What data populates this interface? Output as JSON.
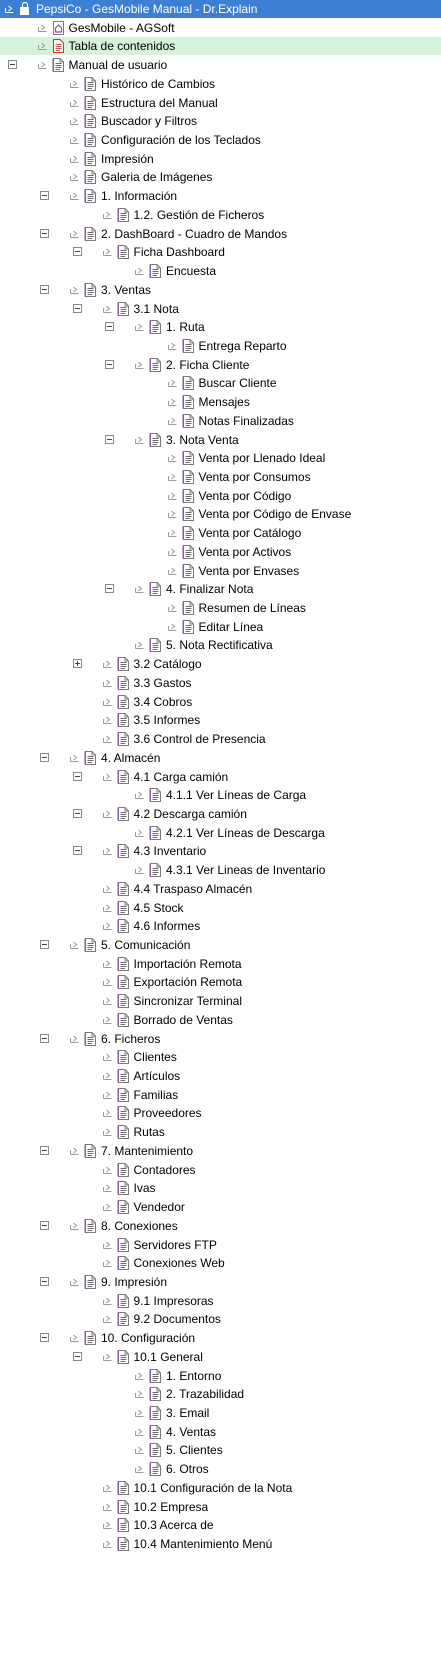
{
  "title": "PepsiCo - GesMobile Manual - Dr.Explain",
  "colors": {
    "selected_bg": "#3d7fd4",
    "highlight_bg": "#d6f2d8",
    "icon_purple": "#8e4fae"
  },
  "tree": [
    {
      "label": "PepsiCo - GesMobile Manual - Dr.Explain",
      "level": 0,
      "icon": "root-icon",
      "selected": true
    },
    {
      "label": "GesMobile - AGSoft",
      "level": 1,
      "icon": "home-icon"
    },
    {
      "label": "Tabla de contenidos",
      "level": 1,
      "icon": "toc-icon",
      "highlight": true
    },
    {
      "label": "Manual de usuario",
      "level": 1,
      "icon": "page-icon",
      "expander": "minus"
    },
    {
      "label": "Histórico de Cambios",
      "level": 2,
      "icon": "page-icon"
    },
    {
      "label": "Estructura del Manual",
      "level": 2,
      "icon": "page-icon"
    },
    {
      "label": "Buscador y Filtros",
      "level": 2,
      "icon": "page-icon"
    },
    {
      "label": "Configuración de los Teclados",
      "level": 2,
      "icon": "page-icon"
    },
    {
      "label": "Impresión",
      "level": 2,
      "icon": "page-icon"
    },
    {
      "label": "Galeria de Imágenes",
      "level": 2,
      "icon": "page-icon"
    },
    {
      "label": "1. Información",
      "level": 2,
      "icon": "page-icon",
      "expander": "minus"
    },
    {
      "label": "1.2. Gestión de Ficheros",
      "level": 3,
      "icon": "page-icon"
    },
    {
      "label": "2. DashBoard - Cuadro de Mandos",
      "level": 2,
      "icon": "page-icon",
      "expander": "minus"
    },
    {
      "label": "Ficha Dashboard",
      "level": 3,
      "icon": "page-icon",
      "expander": "minus"
    },
    {
      "label": "Encuesta",
      "level": 4,
      "icon": "page-icon"
    },
    {
      "label": "3. Ventas",
      "level": 2,
      "icon": "page-icon",
      "expander": "minus"
    },
    {
      "label": "3.1 Nota",
      "level": 3,
      "icon": "page-icon",
      "expander": "minus"
    },
    {
      "label": "1. Ruta",
      "level": 4,
      "icon": "page-icon",
      "expander": "minus"
    },
    {
      "label": "Entrega Reparto",
      "level": 5,
      "icon": "page-icon"
    },
    {
      "label": "2. Ficha Cliente",
      "level": 4,
      "icon": "page-icon",
      "expander": "minus"
    },
    {
      "label": "Buscar Cliente",
      "level": 5,
      "icon": "page-icon"
    },
    {
      "label": "Mensajes",
      "level": 5,
      "icon": "page-icon"
    },
    {
      "label": "Notas Finalizadas",
      "level": 5,
      "icon": "page-icon"
    },
    {
      "label": "3. Nota Venta",
      "level": 4,
      "icon": "page-icon",
      "expander": "minus"
    },
    {
      "label": "Venta por Llenado Ideal",
      "level": 5,
      "icon": "page-icon"
    },
    {
      "label": "Venta por Consumos",
      "level": 5,
      "icon": "page-icon"
    },
    {
      "label": "Venta por Código",
      "level": 5,
      "icon": "page-icon"
    },
    {
      "label": "Venta por Código de Envase",
      "level": 5,
      "icon": "page-icon"
    },
    {
      "label": "Venta por Catálogo",
      "level": 5,
      "icon": "page-icon"
    },
    {
      "label": "Venta por Activos",
      "level": 5,
      "icon": "page-icon"
    },
    {
      "label": "Venta por Envases",
      "level": 5,
      "icon": "page-icon"
    },
    {
      "label": "4. Finalizar Nota",
      "level": 4,
      "icon": "page-icon",
      "expander": "minus"
    },
    {
      "label": "Resumen de Líneas",
      "level": 5,
      "icon": "page-icon"
    },
    {
      "label": "Editar Línea",
      "level": 5,
      "icon": "page-icon"
    },
    {
      "label": "5. Nota Rectificativa",
      "level": 4,
      "icon": "page-icon"
    },
    {
      "label": "3.2 Catálogo",
      "level": 3,
      "icon": "page-icon",
      "expander": "plus"
    },
    {
      "label": "3.3 Gastos",
      "level": 3,
      "icon": "page-icon"
    },
    {
      "label": "3.4 Cobros",
      "level": 3,
      "icon": "page-icon"
    },
    {
      "label": "3.5 Informes",
      "level": 3,
      "icon": "page-icon"
    },
    {
      "label": "3.6 Control de Presencia",
      "level": 3,
      "icon": "page-icon"
    },
    {
      "label": "4. Almacén",
      "level": 2,
      "icon": "page-icon",
      "expander": "minus"
    },
    {
      "label": "4.1 Carga camión",
      "level": 3,
      "icon": "page-icon",
      "expander": "minus"
    },
    {
      "label": "4.1.1 Ver Líneas de Carga",
      "level": 4,
      "icon": "page-icon"
    },
    {
      "label": "4.2 Descarga camión",
      "level": 3,
      "icon": "page-icon",
      "expander": "minus"
    },
    {
      "label": "4.2.1 Ver Líneas de Descarga",
      "level": 4,
      "icon": "page-icon"
    },
    {
      "label": "4.3 Inventario",
      "level": 3,
      "icon": "page-icon",
      "expander": "minus"
    },
    {
      "label": "4.3.1 Ver Lineas de Inventario",
      "level": 4,
      "icon": "page-icon"
    },
    {
      "label": "4.4 Traspaso Almacén",
      "level": 3,
      "icon": "page-icon"
    },
    {
      "label": "4.5 Stock",
      "level": 3,
      "icon": "page-icon"
    },
    {
      "label": "4.6 Informes",
      "level": 3,
      "icon": "page-icon"
    },
    {
      "label": "5. Comunicación",
      "level": 2,
      "icon": "page-icon",
      "expander": "minus"
    },
    {
      "label": "Importación Remota",
      "level": 3,
      "icon": "page-icon"
    },
    {
      "label": "Exportación Remota",
      "level": 3,
      "icon": "page-icon"
    },
    {
      "label": "Sincronizar Terminal",
      "level": 3,
      "icon": "page-icon"
    },
    {
      "label": "Borrado de Ventas",
      "level": 3,
      "icon": "page-icon"
    },
    {
      "label": "6. Ficheros",
      "level": 2,
      "icon": "page-icon",
      "expander": "minus"
    },
    {
      "label": "Clientes",
      "level": 3,
      "icon": "page-icon"
    },
    {
      "label": "Artículos",
      "level": 3,
      "icon": "page-icon"
    },
    {
      "label": "Familias",
      "level": 3,
      "icon": "page-icon"
    },
    {
      "label": "Proveedores",
      "level": 3,
      "icon": "page-icon"
    },
    {
      "label": "Rutas",
      "level": 3,
      "icon": "page-icon"
    },
    {
      "label": "7. Mantenimiento",
      "level": 2,
      "icon": "page-icon",
      "expander": "minus"
    },
    {
      "label": "Contadores",
      "level": 3,
      "icon": "page-icon"
    },
    {
      "label": "Ivas",
      "level": 3,
      "icon": "page-icon"
    },
    {
      "label": "Vendedor",
      "level": 3,
      "icon": "page-icon"
    },
    {
      "label": "8. Conexiones",
      "level": 2,
      "icon": "page-icon",
      "expander": "minus"
    },
    {
      "label": "Servidores FTP",
      "level": 3,
      "icon": "page-icon"
    },
    {
      "label": "Conexiones Web",
      "level": 3,
      "icon": "page-icon"
    },
    {
      "label": "9. Impresión",
      "level": 2,
      "icon": "page-icon",
      "expander": "minus"
    },
    {
      "label": "9.1 Impresoras",
      "level": 3,
      "icon": "page-icon"
    },
    {
      "label": "9.2 Documentos",
      "level": 3,
      "icon": "page-icon"
    },
    {
      "label": "10. Configuración",
      "level": 2,
      "icon": "page-icon",
      "expander": "minus"
    },
    {
      "label": "10.1 General",
      "level": 3,
      "icon": "page-icon",
      "expander": "minus"
    },
    {
      "label": "1. Entorno",
      "level": 4,
      "icon": "page-icon"
    },
    {
      "label": "2. Trazabilidad",
      "level": 4,
      "icon": "page-icon"
    },
    {
      "label": "3. Email",
      "level": 4,
      "icon": "page-icon"
    },
    {
      "label": "4. Ventas",
      "level": 4,
      "icon": "page-icon"
    },
    {
      "label": "5. Clientes",
      "level": 4,
      "icon": "page-icon"
    },
    {
      "label": "6. Otros",
      "level": 4,
      "icon": "page-icon"
    },
    {
      "label": "10.1 Configuración de la Nota",
      "level": 3,
      "icon": "page-icon"
    },
    {
      "label": "10.2 Empresa",
      "level": 3,
      "icon": "page-icon"
    },
    {
      "label": "10.3 Acerca de",
      "level": 3,
      "icon": "page-icon"
    },
    {
      "label": "10.4 Mantenimiento Menú",
      "level": 3,
      "icon": "page-icon"
    }
  ]
}
